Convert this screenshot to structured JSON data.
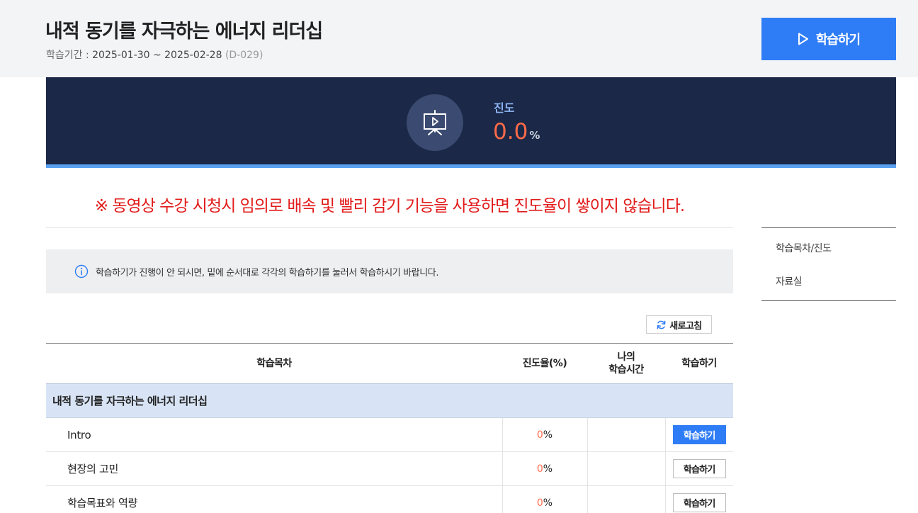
{
  "header": {
    "title": "내적 동기를 자극하는 에너지 리더십",
    "period_label": "학습기간 : ",
    "period_dates": "2025-01-30 ~ 2025-02-28",
    "dday": "(D-029)",
    "start_label": "학습하기"
  },
  "progress": {
    "label": "진도",
    "value": "0.0",
    "unit": "%",
    "fraction": 0.0
  },
  "warning": "※ 동영상 수강 시청시 임의로 배속 및 빨리 감기 기능을 사용하면 진도율이 쌓이지 않습니다.",
  "notice": "학습하기가 진행이 안 되시면, 밑에 순서대로 각각의 학습하기를 눌러서 학습하시기 바랍니다.",
  "refresh_label": "새로고침",
  "table": {
    "headers": {
      "toc": "학습목차",
      "rate": "진도율(%)",
      "time_line1": "나의",
      "time_line2": "학습시간",
      "action": "학습하기"
    },
    "section": "내적 동기를 자극하는 에너지 리더십",
    "rows": [
      {
        "title": "Intro",
        "rate": "0",
        "unit": "%",
        "time": "",
        "action": "학습하기"
      },
      {
        "title": "현장의 고민",
        "rate": "0",
        "unit": "%",
        "time": "",
        "action": "학습하기"
      },
      {
        "title": "학습목표와 역량",
        "rate": "0",
        "unit": "%",
        "time": "",
        "action": "학습하기"
      }
    ]
  },
  "side_nav": {
    "items": [
      {
        "label": "학습목차/진도"
      },
      {
        "label": "자료실"
      }
    ]
  },
  "colors": {
    "primary": "#2f7df6",
    "banner": "#1b2847",
    "accent": "#ff6b4a",
    "warning": "#e21b1b"
  },
  "icons": {
    "start": "play-icon",
    "lecture": "presentation-icon",
    "info": "info-icon",
    "refresh": "refresh-icon"
  }
}
